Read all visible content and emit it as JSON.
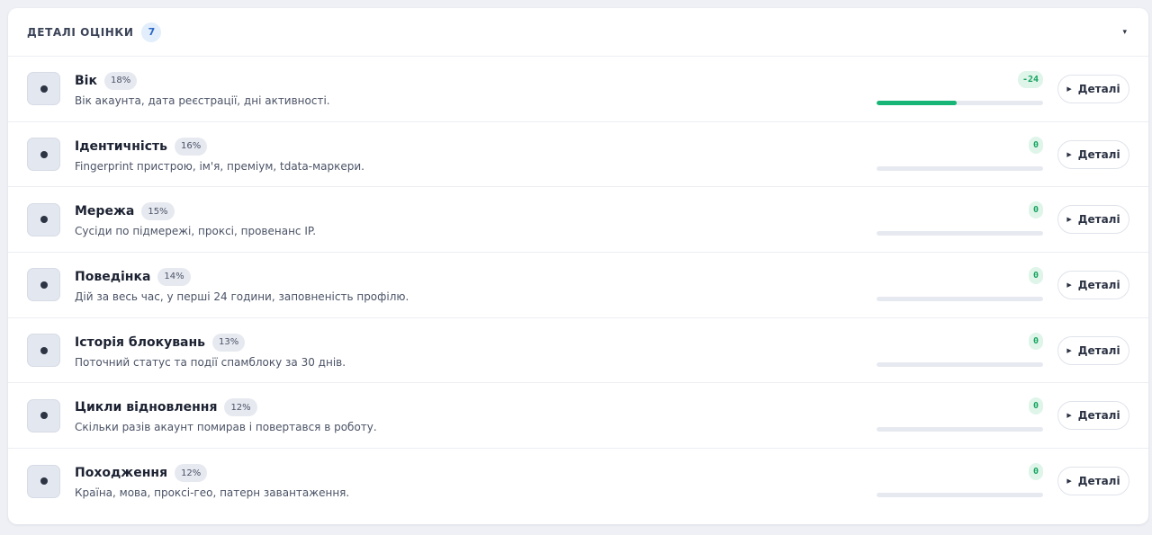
{
  "header": {
    "title": "ДЕТАЛІ ОЦІНКИ",
    "count": "7",
    "collapse_icon": "▾"
  },
  "colors": {
    "accent": "#17b576",
    "score_bg": "#dff5ea",
    "score_text": "#16a35f"
  },
  "details_label": "Деталі",
  "rows": [
    {
      "title": "Вік",
      "weight": "18%",
      "description": "Вік акаунта, дата реєстрації, дні активності.",
      "score": "-24",
      "progress": 0.48
    },
    {
      "title": "Ідентичність",
      "weight": "16%",
      "description": "Fingerprint пристрою, ім'я, преміум, tdata-маркери.",
      "score": "0",
      "progress": 0
    },
    {
      "title": "Мережа",
      "weight": "15%",
      "description": "Сусіди по підмережі, проксі, провенанс IP.",
      "score": "0",
      "progress": 0
    },
    {
      "title": "Поведінка",
      "weight": "14%",
      "description": "Дій за весь час, у перші 24 години, заповненість профілю.",
      "score": "0",
      "progress": 0
    },
    {
      "title": "Історія блокувань",
      "weight": "13%",
      "description": "Поточний статус та події спамблоку за 30 днів.",
      "score": "0",
      "progress": 0
    },
    {
      "title": "Цикли відновлення",
      "weight": "12%",
      "description": "Скільки разів акаунт помирав і повертався в роботу.",
      "score": "0",
      "progress": 0
    },
    {
      "title": "Походження",
      "weight": "12%",
      "description": "Країна, мова, проксі-гео, патерн завантаження.",
      "score": "0",
      "progress": 0
    }
  ]
}
